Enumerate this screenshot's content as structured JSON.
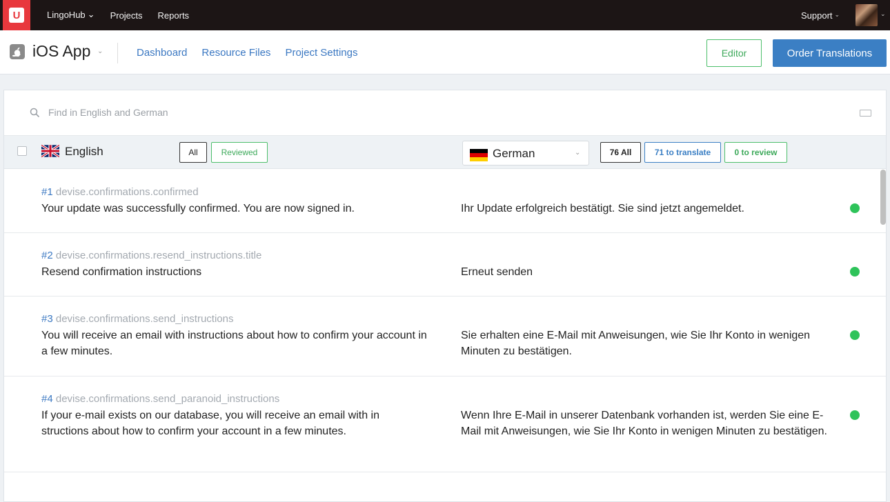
{
  "topbar": {
    "logo_letter": "U",
    "nav": [
      "LingoHub",
      "Projects",
      "Reports"
    ],
    "support_label": "Support"
  },
  "header": {
    "app_title": "iOS App",
    "subnav": [
      "Dashboard",
      "Resource Files",
      "Project Settings"
    ],
    "editor_label": "Editor",
    "order_label": "Order Translations"
  },
  "search": {
    "placeholder": "Find in English and German"
  },
  "filters": {
    "source_lang": "English",
    "source_all": "All",
    "source_reviewed": "Reviewed",
    "target_lang": "German",
    "target_all": "76 All",
    "target_to_translate": "71 to translate",
    "target_to_review": "0 to review"
  },
  "rows": [
    {
      "num": "#1",
      "key": "devise.confirmations.confirmed",
      "source": "Your update was successfully confirmed. You are now signed in.",
      "target": "Ihr Update erfolgreich bestätigt. Sie sind jetzt angemeldet.",
      "status_color": "#2ec35a"
    },
    {
      "num": "#2",
      "key": "devise.confirmations.resend_instructions.title",
      "source": "Resend confirmation instructions",
      "target": "Erneut senden",
      "status_color": "#2ec35a"
    },
    {
      "num": "#3",
      "key": "devise.confirmations.send_instructions",
      "source": "You will receive an email with instructions about how to confirm your account in a few minutes.",
      "target": "Sie erhalten eine E-Mail mit Anweisungen, wie Sie Ihr Konto in wenigen Minuten zu bestätigen.",
      "status_color": "#2ec35a"
    },
    {
      "num": "#4",
      "key": "devise.confirmations.send_paranoid_instructions",
      "source": "If your e-mail exists on our database, you will receive an email with in structions about how to confirm your account in a few minutes.",
      "target": "Wenn Ihre E-Mail in unserer Datenbank vorhanden ist, werden Sie eine E-Mail mit Anweisungen, wie Sie Ihr Konto in wenigen Minuten zu bestätigen.",
      "status_color": "#2ec35a"
    }
  ],
  "colors": {
    "topbar_bg": "#1c1515",
    "logo_red": "#e8383d",
    "link_blue": "#3b78c2",
    "primary_blue": "#3b7fc4",
    "success_green": "#2ec35a"
  }
}
